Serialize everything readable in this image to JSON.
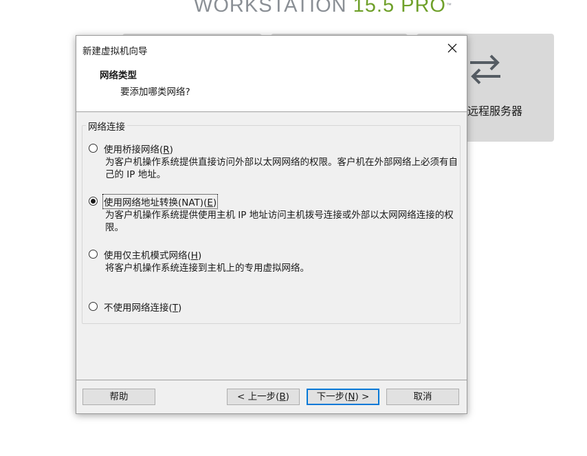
{
  "background": {
    "logo_prefix": "WORKSTATION ",
    "logo_version": "15.5 PRO",
    "logo_tm": "™",
    "card_remote_label": "远程服务器",
    "card_remote_icon": "transfer-arrows-icon"
  },
  "dialog": {
    "title": "新建虚拟机向导",
    "close_icon": "close-icon",
    "heading": "网络类型",
    "subheading": "要添加哪类网络?",
    "group_label": "网络连接",
    "options": [
      {
        "label_pre": "使用桥接网络(",
        "key": "R",
        "label_post": ")",
        "desc": "为客户机操作系统提供直接访问外部以太网网络的权限。客户机在外部网络上必须有自己的 IP 地址。",
        "checked": false
      },
      {
        "label_pre": "使用网络地址转换(NAT)(",
        "key": "E",
        "label_post": ")",
        "desc": "为客户机操作系统提供使用主机 IP 地址访问主机拨号连接或外部以太网网络连接的权限。",
        "checked": true
      },
      {
        "label_pre": "使用仅主机模式网络(",
        "key": "H",
        "label_post": ")",
        "desc": "将客户机操作系统连接到主机上的专用虚拟网络。",
        "checked": false
      },
      {
        "label_pre": "不使用网络连接(",
        "key": "T",
        "label_post": ")",
        "desc": "",
        "checked": false
      }
    ],
    "buttons": {
      "help": "帮助",
      "back_pre": "< 上一步(",
      "back_key": "B",
      "back_post": ")",
      "next_pre": "下一步(",
      "next_key": "N",
      "next_post": ") >",
      "cancel": "取消"
    }
  },
  "colors": {
    "accent": "#0078d7",
    "logo_version": "#6fa02a"
  }
}
